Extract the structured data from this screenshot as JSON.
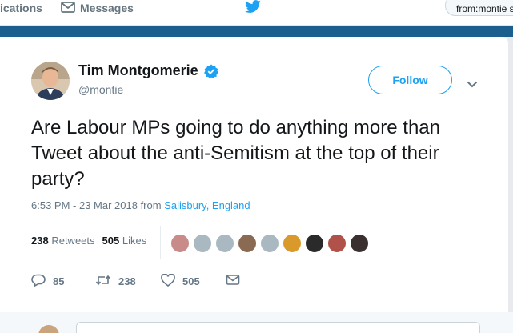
{
  "nav": {
    "notifications_label": "ications",
    "messages_label": "Messages",
    "search_value": "from:montie s"
  },
  "tweet": {
    "author_name": "Tim Montgomerie",
    "author_handle": "@montie",
    "follow_label": "Follow",
    "text": "Are Labour MPs going to do anything more than Tweet about the anti-Semitism at the top of their party?",
    "timestamp": "6:53 PM - 23 Mar 2018 from ",
    "location": "Salisbury, England",
    "retweets_count": "238",
    "retweets_label": "Retweets",
    "likes_count": "505",
    "likes_label": "Likes",
    "actions": {
      "reply_count": "85",
      "retweet_count": "238",
      "like_count": "505"
    }
  },
  "colors": {
    "accent": "#1da1f2",
    "header_bar": "#1b5f8e",
    "muted": "#657786"
  },
  "icons": [
    "envelope-icon",
    "twitter-bird-icon",
    "verified-badge-icon",
    "chevron-down-icon",
    "reply-icon",
    "retweet-icon",
    "like-icon",
    "direct-message-icon"
  ]
}
